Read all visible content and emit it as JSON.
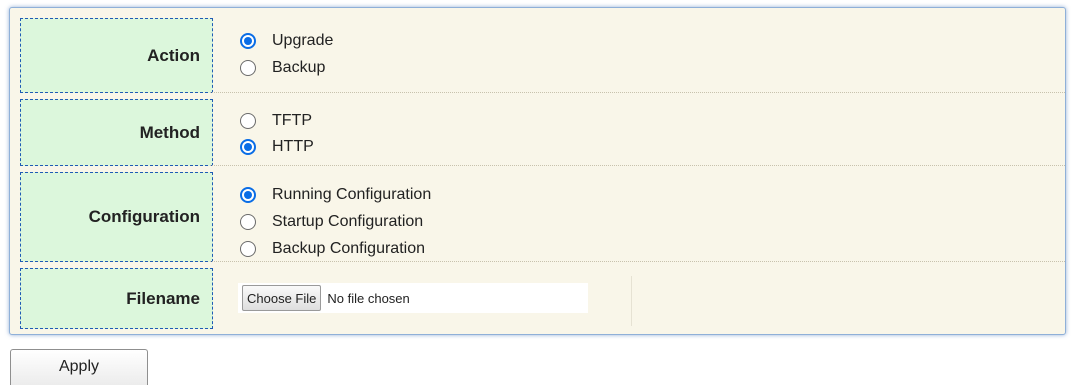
{
  "form": {
    "rows": [
      {
        "label": "Action",
        "options": [
          {
            "label": "Upgrade",
            "selected": true
          },
          {
            "label": "Backup",
            "selected": false
          }
        ]
      },
      {
        "label": "Method",
        "options": [
          {
            "label": "TFTP",
            "selected": false
          },
          {
            "label": "HTTP",
            "selected": true
          }
        ]
      },
      {
        "label": "Configuration",
        "options": [
          {
            "label": "Running Configuration",
            "selected": true
          },
          {
            "label": "Startup Configuration",
            "selected": false
          },
          {
            "label": "Backup Configuration",
            "selected": false
          }
        ]
      },
      {
        "label": "Filename",
        "file_button": "Choose File",
        "file_status": "No file chosen"
      }
    ]
  },
  "apply_label": "Apply",
  "colors": {
    "label_bg": "#dcf7dc",
    "label_border": "#1f5bb5",
    "panel_bg": "#f9f6e9",
    "radio_selected": "#0a6de6"
  }
}
